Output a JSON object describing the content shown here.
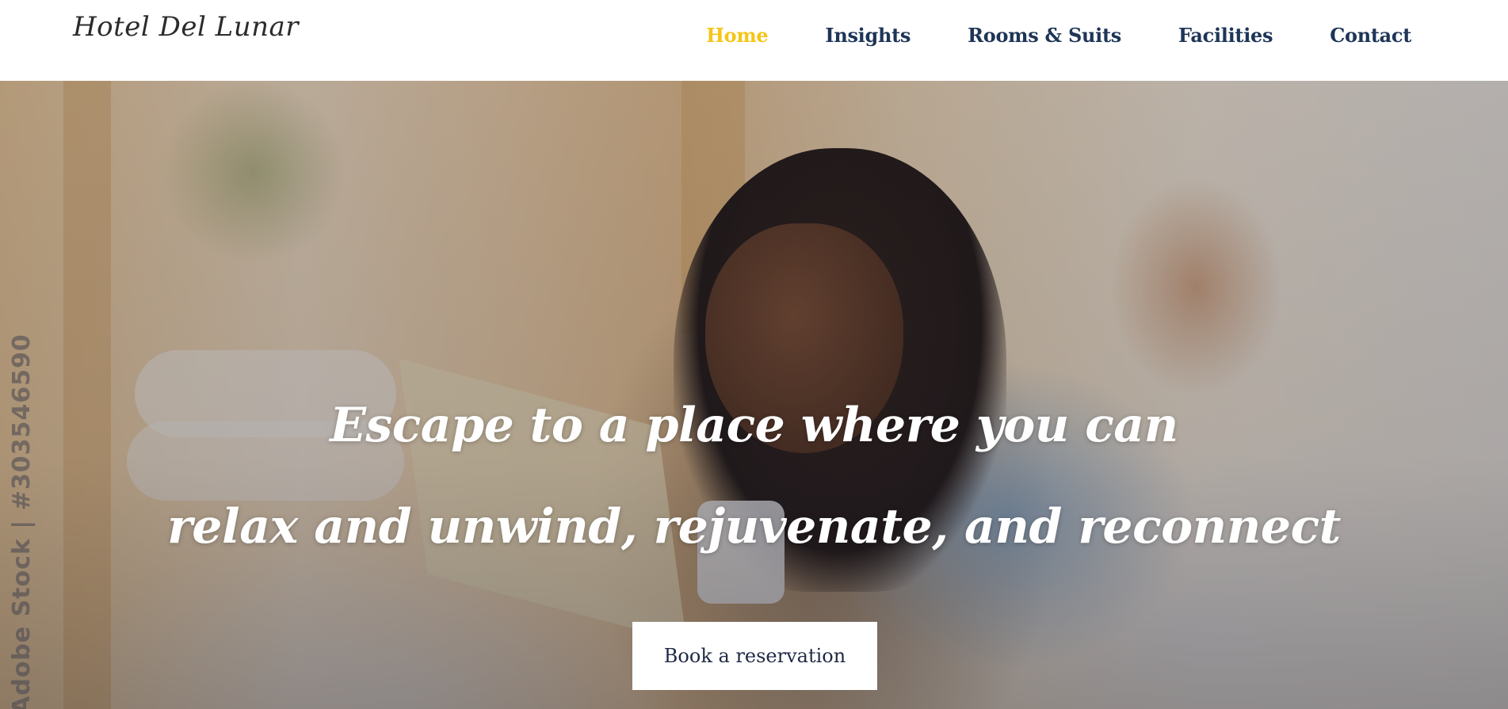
{
  "header": {
    "logo_text": "Hotel Del Lunar",
    "nav": [
      {
        "label": "Home",
        "active": true
      },
      {
        "label": "Insights",
        "active": false
      },
      {
        "label": "Rooms & Suits",
        "active": false
      },
      {
        "label": "Facilities",
        "active": false
      },
      {
        "label": "Contact",
        "active": false
      }
    ]
  },
  "hero": {
    "headline_line1": "Escape to a place where you can",
    "headline_line2": "relax and unwind, rejuvenate, and reconnect",
    "cta_label": "Book a reservation",
    "watermark": "Adobe Stock | #303546590"
  },
  "colors": {
    "nav_text": "#1e3557",
    "nav_active": "#f5c518",
    "headline": "#ffffff",
    "cta_bg": "#ffffff",
    "cta_text": "#1e2a44"
  }
}
